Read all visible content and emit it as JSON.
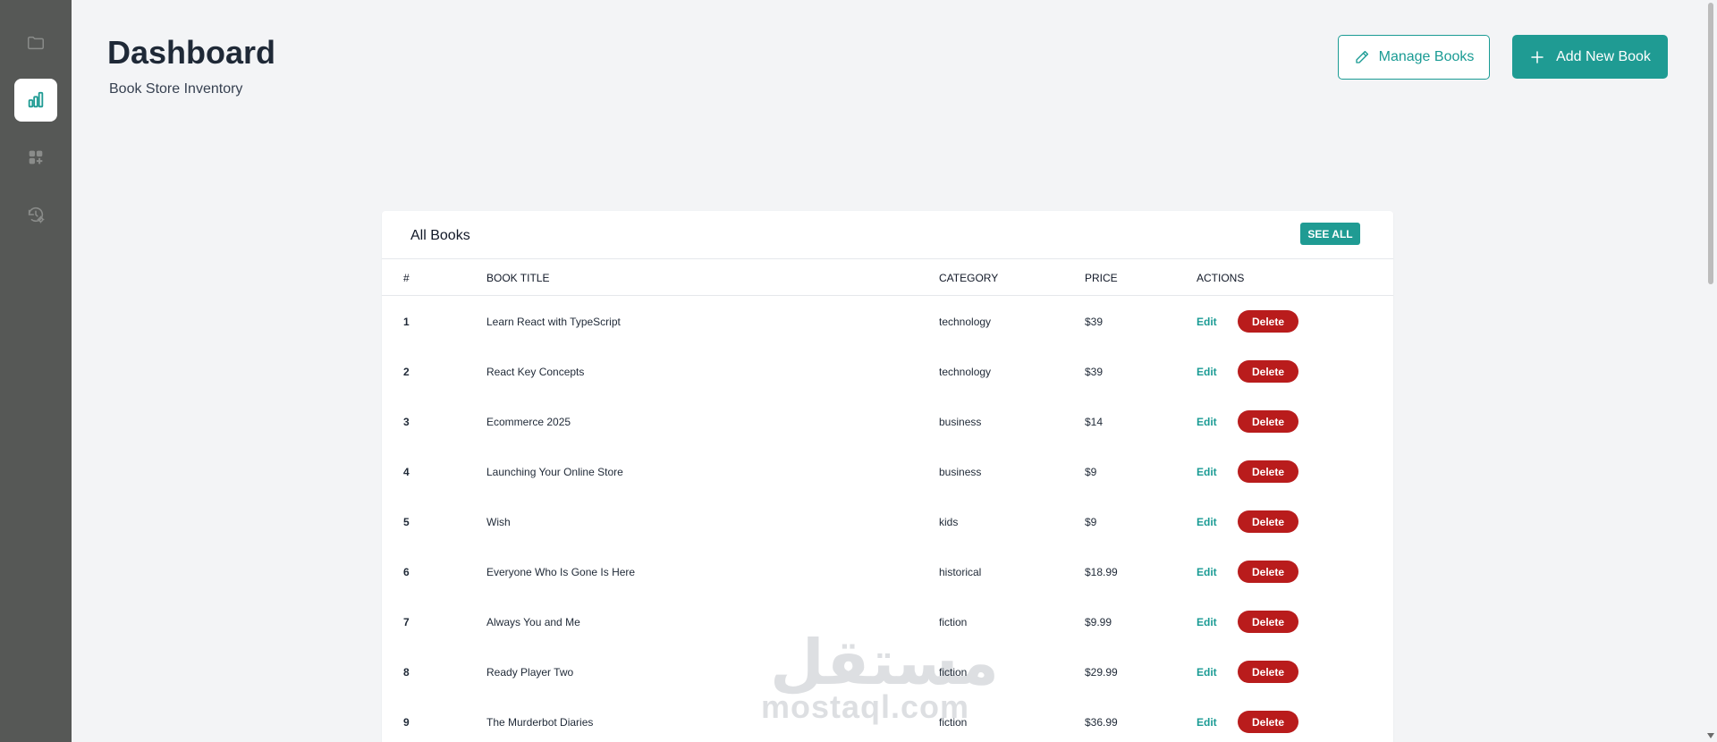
{
  "header": {
    "title": "Dashboard",
    "subtitle": "Book Store Inventory",
    "manage_label": "Manage Books",
    "add_label": "Add New Book"
  },
  "sidebar": {
    "items": [
      {
        "icon": "folder-icon"
      },
      {
        "icon": "bar-chart-icon",
        "active": true
      },
      {
        "icon": "apps-icon"
      },
      {
        "icon": "history-settings-icon"
      }
    ]
  },
  "card": {
    "title": "All Books",
    "see_all_label": "SEE ALL",
    "columns": [
      "#",
      "BOOK TITLE",
      "CATEGORY",
      "PRICE",
      "ACTIONS"
    ],
    "edit_label": "Edit",
    "delete_label": "Delete",
    "rows": [
      {
        "num": "1",
        "title": "Learn React with TypeScript",
        "category": "technology",
        "price": "$39"
      },
      {
        "num": "2",
        "title": "React Key Concepts",
        "category": "technology",
        "price": "$39"
      },
      {
        "num": "3",
        "title": "Ecommerce 2025",
        "category": "business",
        "price": "$14"
      },
      {
        "num": "4",
        "title": "Launching Your Online Store",
        "category": "business",
        "price": "$9"
      },
      {
        "num": "5",
        "title": "Wish",
        "category": "kids",
        "price": "$9"
      },
      {
        "num": "6",
        "title": "Everyone Who Is Gone Is Here",
        "category": "historical",
        "price": "$18.99"
      },
      {
        "num": "7",
        "title": "Always You and Me",
        "category": "fiction",
        "price": "$9.99"
      },
      {
        "num": "8",
        "title": "Ready Player Two",
        "category": "fiction",
        "price": "$29.99"
      },
      {
        "num": "9",
        "title": "The Murderbot Diaries",
        "category": "fiction",
        "price": "$36.99"
      }
    ]
  },
  "watermark": {
    "arabic": "مستقل",
    "latin": "mostaql.com"
  },
  "colors": {
    "accent": "#1f9b93",
    "danger": "#b91c1c",
    "sidebar": "#565856",
    "background": "#f3f4f6"
  }
}
